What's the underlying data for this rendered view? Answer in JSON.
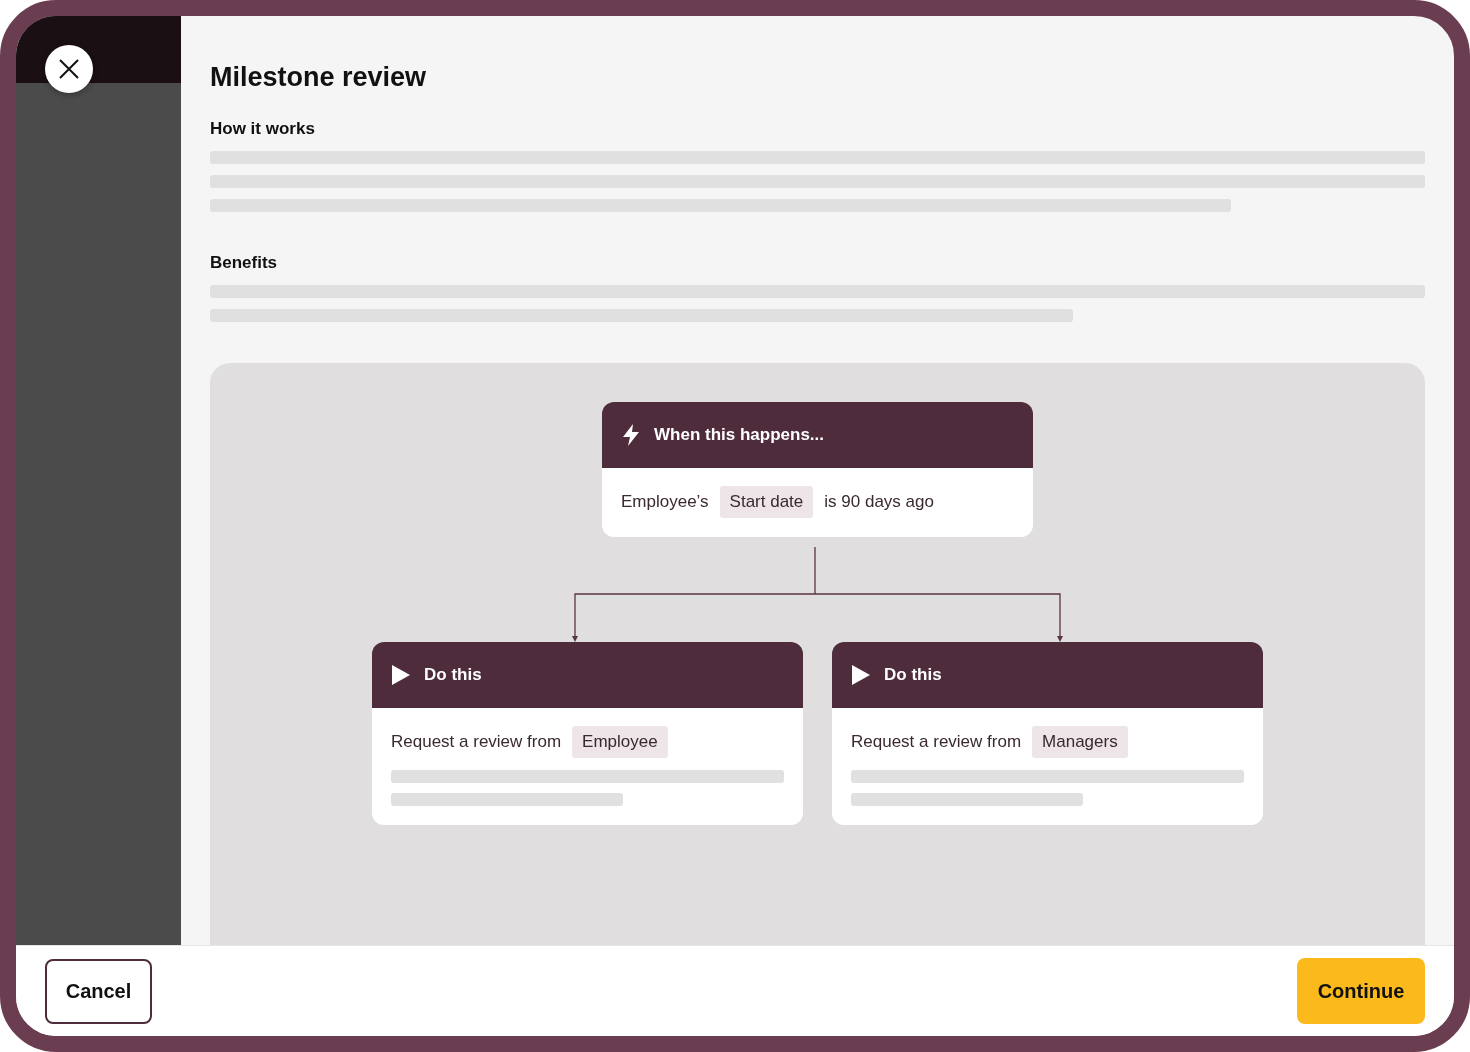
{
  "title": "Milestone review",
  "sections": [
    {
      "heading": "How it works"
    },
    {
      "heading": "Benefits"
    }
  ],
  "trigger": {
    "title": "When this happens...",
    "body": [
      {
        "kind": "text",
        "text": "Employee’s"
      },
      {
        "kind": "chip",
        "text": "Start date"
      },
      {
        "kind": "text",
        "text": "is 90 days ago"
      }
    ]
  },
  "actions": [
    {
      "title": "Do this",
      "body": [
        {
          "kind": "text",
          "text": "Request a review from"
        },
        {
          "kind": "chip",
          "text": "Employee"
        }
      ]
    },
    {
      "title": "Do this",
      "body": [
        {
          "kind": "text",
          "text": "Request a review from"
        },
        {
          "kind": "chip",
          "text": "Managers"
        }
      ]
    }
  ],
  "footer": {
    "cancel": "Cancel",
    "continue": "Continue"
  }
}
